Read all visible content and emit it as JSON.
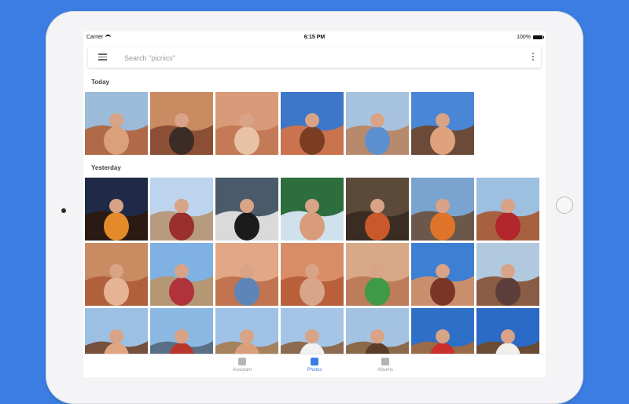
{
  "status_bar": {
    "carrier": "Carrier",
    "time": "6:15 PM",
    "battery": "100%"
  },
  "search": {
    "placeholder": "Search \"picnics\""
  },
  "sections": [
    {
      "label": "Today",
      "photos": [
        {
          "name": "family-selfie-canyon",
          "sky": "#9bbbd8",
          "ground": "#b06a4a",
          "subject": "#d9a07a"
        },
        {
          "name": "mother-child-hiking",
          "sky": "#c98b62",
          "ground": "#8a4f35",
          "subject": "#3b2c25"
        },
        {
          "name": "family-red-rocks",
          "sky": "#d89a78",
          "ground": "#c47a57",
          "subject": "#e7c2a4"
        },
        {
          "name": "child-on-rock-arch",
          "sky": "#3f77c8",
          "ground": "#c9744e",
          "subject": "#7a3d22"
        },
        {
          "name": "boy-on-rocks",
          "sky": "#a7c3e0",
          "ground": "#b78a6e",
          "subject": "#5c8fd0"
        },
        {
          "name": "couple-blue-sky",
          "sky": "#4a86d6",
          "ground": "#6b4a3a",
          "subject": "#e0a27c"
        }
      ]
    },
    {
      "label": "Yesterday",
      "photos": [
        {
          "name": "campfire-night",
          "sky": "#1e2a48",
          "ground": "#2a1a12",
          "subject": "#e38a2a"
        },
        {
          "name": "picnic-table-desert",
          "sky": "#bcd4ee",
          "ground": "#b79b80",
          "subject": "#9b2e2e"
        },
        {
          "name": "campfire-cooking-pot",
          "sky": "#4a5a6a",
          "ground": "#dadada",
          "subject": "#1b1b1b"
        },
        {
          "name": "child-in-tent",
          "sky": "#2e6e3e",
          "ground": "#cfe1ec",
          "subject": "#d99c7a"
        },
        {
          "name": "dutch-oven-fire",
          "sky": "#5b4a3a",
          "ground": "#3a2c22",
          "subject": "#c9582a"
        },
        {
          "name": "desert-campfire-dusk",
          "sky": "#7aa3cf",
          "ground": "#6c584a",
          "subject": "#e0732a"
        },
        {
          "name": "person-lying-red-shirt",
          "sky": "#9dbfe0",
          "ground": "#a7613f",
          "subject": "#b2262c"
        },
        {
          "name": "toddler-close-up",
          "sky": "#c98b62",
          "ground": "#b0613c",
          "subject": "#e6b394"
        },
        {
          "name": "hikers-open-desert",
          "sky": "#7fb1e2",
          "ground": "#b59774",
          "subject": "#b0323a"
        },
        {
          "name": "child-in-rock-hole",
          "sky": "#e2a784",
          "ground": "#c27450",
          "subject": "#5d85b8"
        },
        {
          "name": "boy-peeking-rock",
          "sky": "#d88d66",
          "ground": "#b9603b",
          "subject": "#d8a588"
        },
        {
          "name": "woman-green-shirt",
          "sky": "#d8a887",
          "ground": "#bd7c5a",
          "subject": "#3f9a45"
        },
        {
          "name": "man-red-rocks-sky",
          "sky": "#3d7fd2",
          "ground": "#c98f6c",
          "subject": "#7b3526"
        },
        {
          "name": "girl-on-rock-ledge",
          "sky": "#b0c9de",
          "ground": "#8b5c45",
          "subject": "#5c3f3a"
        },
        {
          "name": "family-selfie-sunglasses",
          "sky": "#9cc0e3",
          "ground": "#74503d",
          "subject": "#e0a682"
        },
        {
          "name": "kids-by-car",
          "sky": "#8cb8e4",
          "ground": "#5a6f85",
          "subject": "#b8372c"
        },
        {
          "name": "family-hug-desert",
          "sky": "#9fc2e6",
          "ground": "#a5825e",
          "subject": "#d9a07a"
        },
        {
          "name": "woman-mountains",
          "sky": "#a5c5e6",
          "ground": "#8c6b50",
          "subject": "#f1f1f1"
        },
        {
          "name": "horseback-riders",
          "sky": "#a4c3e2",
          "ground": "#8b6a4a",
          "subject": "#5a3c2a"
        },
        {
          "name": "rider-blue-sky",
          "sky": "#2e6fc7",
          "ground": "#9a6b48",
          "subject": "#c9302c"
        },
        {
          "name": "horse-ride-hat",
          "sky": "#2b6ac6",
          "ground": "#6a4b34",
          "subject": "#f1efe9"
        }
      ]
    }
  ],
  "tabs": [
    {
      "label": "Assistant",
      "icon": "assistant-icon",
      "active": false
    },
    {
      "label": "Photos",
      "icon": "photos-icon",
      "active": true
    },
    {
      "label": "Albums",
      "icon": "albums-icon",
      "active": false
    }
  ],
  "colors": {
    "accent": "#3b7de3",
    "background": "#3b7de3"
  }
}
